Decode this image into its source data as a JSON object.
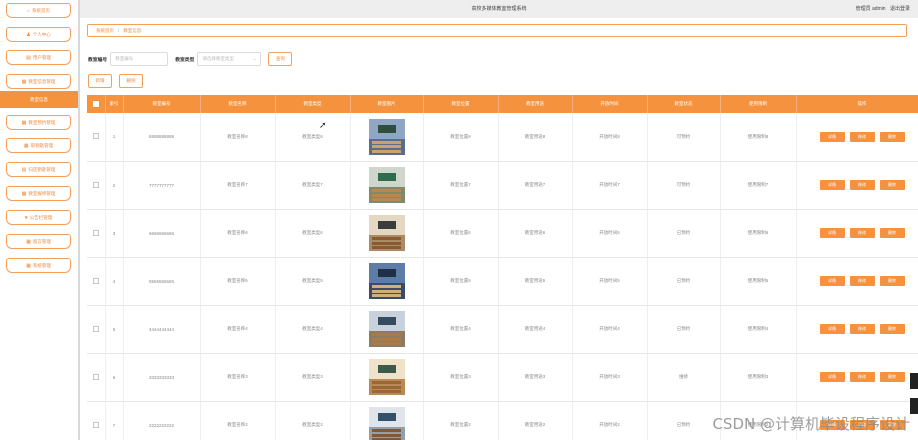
{
  "header": {
    "system_title": "高校多媒体教室管理系统",
    "user_label": "管理员 admin",
    "logout_label": "退出登录"
  },
  "sidebar": {
    "items": [
      {
        "label": "系统首页",
        "icon": "home-icon",
        "glyph": "⌂"
      },
      {
        "label": "个人中心",
        "icon": "user-icon",
        "glyph": "♟"
      },
      {
        "label": "用户管理",
        "icon": "building-icon",
        "glyph": "▤"
      },
      {
        "label": "教室信息管理",
        "icon": "grid-icon",
        "glyph": "▦"
      },
      {
        "label": "教室信息",
        "icon": "",
        "glyph": "",
        "active": true
      },
      {
        "label": "教室预约管理",
        "icon": "calendar-icon",
        "glyph": "▦"
      },
      {
        "label": "取钥匙管理",
        "icon": "grid-icon",
        "glyph": "▦"
      },
      {
        "label": "归还钥匙管理",
        "icon": "doc-icon",
        "glyph": "▤"
      },
      {
        "label": "教室报修管理",
        "icon": "grid-icon",
        "glyph": "▦"
      },
      {
        "label": "公告栏管理",
        "icon": "pin-icon",
        "glyph": "♥"
      },
      {
        "label": "留言管理",
        "icon": "grid-icon",
        "glyph": "▦"
      },
      {
        "label": "系统管理",
        "icon": "grid-icon",
        "glyph": "▦"
      }
    ]
  },
  "breadcrumb": {
    "home": "系统首页",
    "separator": "/",
    "current": "教室信息"
  },
  "search": {
    "room_no_label": "教室编号",
    "room_no_placeholder": "教室编号",
    "room_type_label": "教室类型",
    "room_type_placeholder": "请选择教室类型",
    "search_button": "查询"
  },
  "actions": {
    "add": "新增",
    "delete": "删除"
  },
  "table": {
    "columns": [
      "",
      "索引",
      "教室编号",
      "教室名称",
      "教室类型",
      "教室图片",
      "教室位置",
      "教室用途",
      "开放时间",
      "教室状态",
      "使用限制",
      "操作"
    ],
    "op_detail": "详情",
    "op_edit": "修改",
    "op_delete": "删除",
    "rows": [
      {
        "index": "1",
        "no": "8888888888",
        "name": "教室名称8",
        "type": "教室类型8",
        "loc": "教室位置8",
        "use": "教室用途8",
        "open": "开放时间8",
        "status": "可预约",
        "limit": "使用限制8"
      },
      {
        "index": "2",
        "no": "7777777777",
        "name": "教室名称7",
        "type": "教室类型7",
        "loc": "教室位置7",
        "use": "教室用途7",
        "open": "开放时间7",
        "status": "可预约",
        "limit": "使用限制7"
      },
      {
        "index": "3",
        "no": "6666666666",
        "name": "教室名称6",
        "type": "教室类型6",
        "loc": "教室位置6",
        "use": "教室用途6",
        "open": "开放时间6",
        "status": "已预约",
        "limit": "使用限制6"
      },
      {
        "index": "4",
        "no": "5555555555",
        "name": "教室名称5",
        "type": "教室类型5",
        "loc": "教室位置5",
        "use": "教室用途5",
        "open": "开放时间5",
        "status": "已预约",
        "limit": "使用限制5"
      },
      {
        "index": "5",
        "no": "4444444444",
        "name": "教室名称4",
        "type": "教室类型4",
        "loc": "教室位置4",
        "use": "教室用途4",
        "open": "开放时间4",
        "status": "已预约",
        "limit": "使用限制4"
      },
      {
        "index": "6",
        "no": "3333333333",
        "name": "教室名称3",
        "type": "教室类型3",
        "loc": "教室位置3",
        "use": "教室用途3",
        "open": "开放时间3",
        "status": "维修",
        "limit": "使用限制3"
      },
      {
        "index": "7",
        "no": "2222222222",
        "name": "教室名称2",
        "type": "教室类型2",
        "loc": "教室位置2",
        "use": "教室用途2",
        "open": "开放时间2",
        "status": "已预约",
        "limit": "使用限制2"
      }
    ]
  },
  "photos": [
    {
      "wall": "#8fa7c4",
      "floor": "#5a6e8c",
      "board": "#2e4f3c",
      "desk": "#c9a46a"
    },
    {
      "wall": "#cfd6cc",
      "floor": "#7d8a6c",
      "board": "#2f6b4f",
      "desk": "#b9874f"
    },
    {
      "wall": "#e4d8c3",
      "floor": "#a98b65",
      "board": "#3b3b3b",
      "desk": "#8a5a32"
    },
    {
      "wall": "#5e7da6",
      "floor": "#3a4c68",
      "board": "#1f2f45",
      "desk": "#d2b07a"
    },
    {
      "wall": "#c7d2dc",
      "floor": "#8b7c63",
      "board": "#344c5e",
      "desk": "#a87b48"
    },
    {
      "wall": "#efe2c8",
      "floor": "#b68b55",
      "board": "#3c5a4a",
      "desk": "#9c6736"
    },
    {
      "wall": "#dfe5ea",
      "floor": "#93a0ab",
      "board": "#35506a",
      "desk": "#7d5a3c"
    }
  ],
  "watermark": "CSDN @计算机毕设程序设计",
  "colors": {
    "accent": "#f5923e",
    "accent_border": "#f3a15a"
  }
}
